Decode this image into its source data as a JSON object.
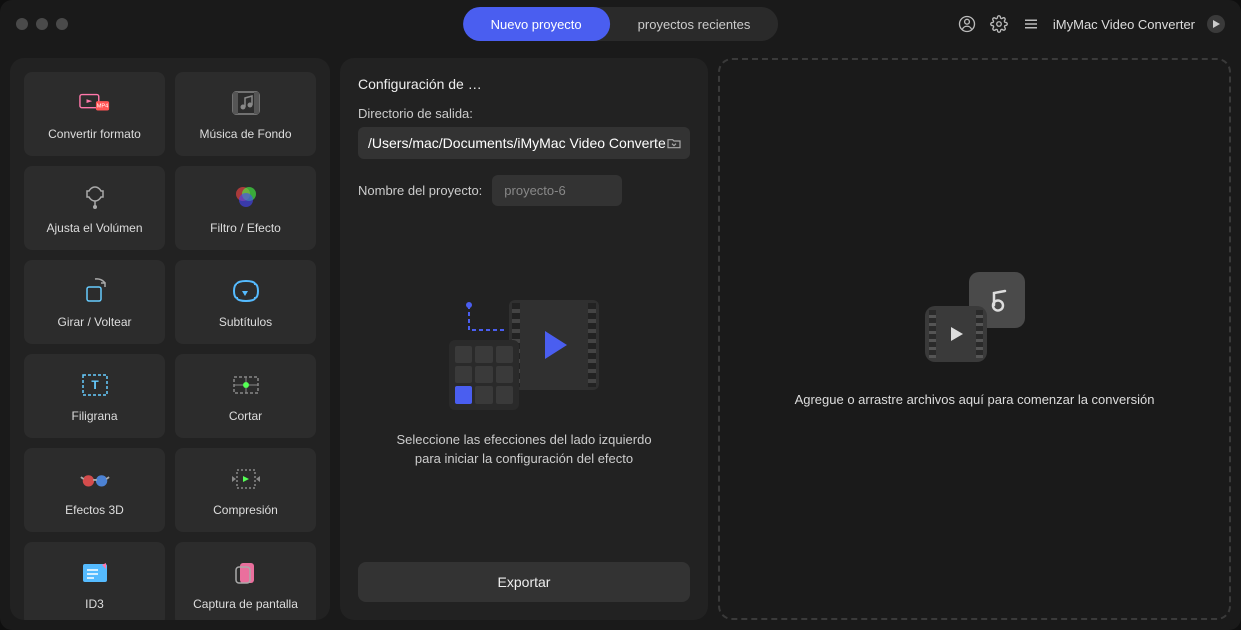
{
  "titlebar": {
    "tabs": {
      "new_project": "Nuevo proyecto",
      "recent_projects": "proyectos recientes"
    },
    "app_name": "iMyMac Video Converter"
  },
  "tools": {
    "convert_format": "Convertir formato",
    "background_music": "Música de Fondo",
    "adjust_volume": "Ajusta el Volúmen",
    "filter_effect": "Filtro / Efecto",
    "rotate_flip": "Girar / Voltear",
    "subtitles": "Subtítulos",
    "watermark": "Filigrana",
    "cut": "Cortar",
    "effects_3d": "Efectos 3D",
    "compression": "Compresión",
    "id3": "ID3",
    "screenshot": "Captura de pantalla"
  },
  "config": {
    "title": "Configuración de …",
    "output_dir_label": "Directorio de salida:",
    "output_dir_value": "/Users/mac/Documents/iMyMac Video Converte",
    "project_name_label": "Nombre del proyecto:",
    "project_name_value": "proyecto-6",
    "instruction": "Seleccione las efecciones del lado izquierdo para iniciar la configuración del efecto",
    "export_label": "Exportar"
  },
  "drop": {
    "instruction": "Agregue o arrastre archivos aquí para comenzar la conversión"
  }
}
